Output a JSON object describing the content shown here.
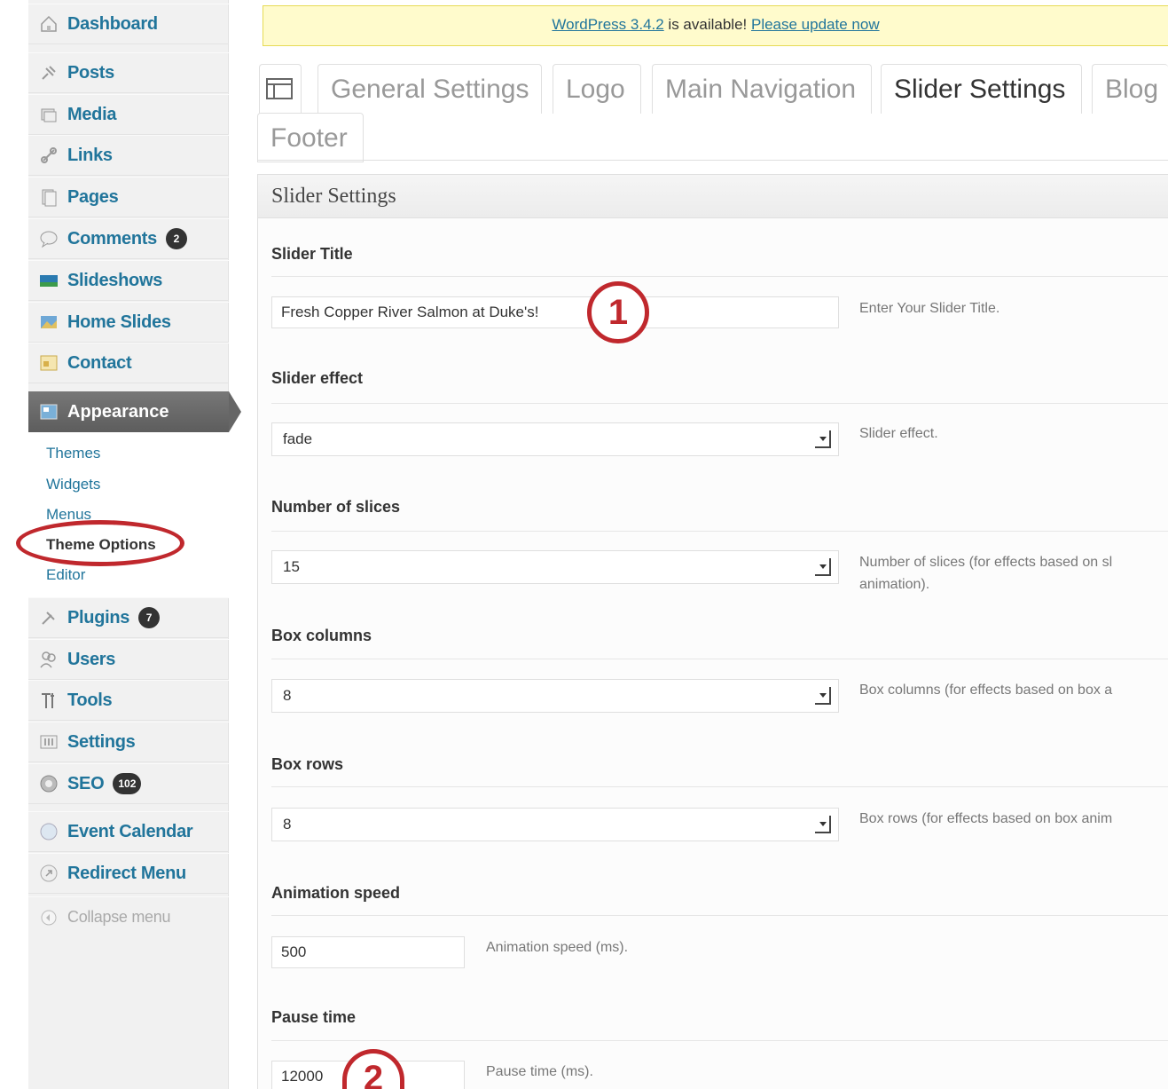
{
  "sidebar": {
    "items": [
      {
        "label": "Dashboard",
        "icon": "home-icon"
      },
      {
        "label": "Posts",
        "icon": "pin-icon"
      },
      {
        "label": "Media",
        "icon": "media-icon"
      },
      {
        "label": "Links",
        "icon": "link-icon"
      },
      {
        "label": "Pages",
        "icon": "pages-icon"
      },
      {
        "label": "Comments",
        "icon": "comment-icon",
        "badge": "2"
      },
      {
        "label": "Slideshows",
        "icon": "slideshow-icon"
      },
      {
        "label": "Home Slides",
        "icon": "image-icon"
      },
      {
        "label": "Contact",
        "icon": "contact-icon"
      },
      {
        "label": "Appearance",
        "icon": "appearance-icon"
      },
      {
        "label": "Plugins",
        "icon": "plug-icon",
        "badge": "7"
      },
      {
        "label": "Users",
        "icon": "users-icon"
      },
      {
        "label": "Tools",
        "icon": "tools-icon"
      },
      {
        "label": "Settings",
        "icon": "settings-icon"
      },
      {
        "label": "SEO",
        "icon": "seo-icon",
        "badge": "102"
      },
      {
        "label": "Event Calendar",
        "icon": "calendar-icon"
      },
      {
        "label": "Redirect Menu",
        "icon": "redirect-icon"
      },
      {
        "label": "Collapse menu",
        "icon": "collapse-icon"
      }
    ],
    "submenu": [
      "Themes",
      "Widgets",
      "Menus",
      "Theme Options",
      "Editor"
    ]
  },
  "notice": {
    "text_before": "WordPress 3.4.2",
    "text_middle": " is available! ",
    "link": "Please update now"
  },
  "tabs": [
    "General Settings",
    "Logo",
    "Main Navigation",
    "Slider Settings",
    "Blog",
    "Footer"
  ],
  "active_tab": "Slider Settings",
  "section_title": "Slider Settings",
  "fields": {
    "slider_title": {
      "label": "Slider Title",
      "value": "Fresh Copper River Salmon at Duke's!",
      "desc": "Enter Your Slider Title."
    },
    "slider_effect": {
      "label": "Slider effect",
      "value": "fade",
      "desc": "Slider effect."
    },
    "slices": {
      "label": "Number of slices",
      "value": "15",
      "desc_line1": "Number of slices (for effects based on sl",
      "desc_line2": "animation)."
    },
    "box_columns": {
      "label": "Box columns",
      "value": "8",
      "desc": "Box columns (for effects based on box a"
    },
    "box_rows": {
      "label": "Box rows",
      "value": "8",
      "desc": "Box rows (for effects based on box anim"
    },
    "animation_speed": {
      "label": "Animation speed",
      "value": "500",
      "desc": "Animation speed (ms)."
    },
    "pause_time": {
      "label": "Pause time",
      "value": "12000",
      "desc": "Pause time (ms)."
    }
  },
  "callouts": [
    "1",
    "2"
  ],
  "colors": {
    "link": "#21759b",
    "annotation": "#c0282d",
    "notice_bg": "#fffbcc"
  }
}
